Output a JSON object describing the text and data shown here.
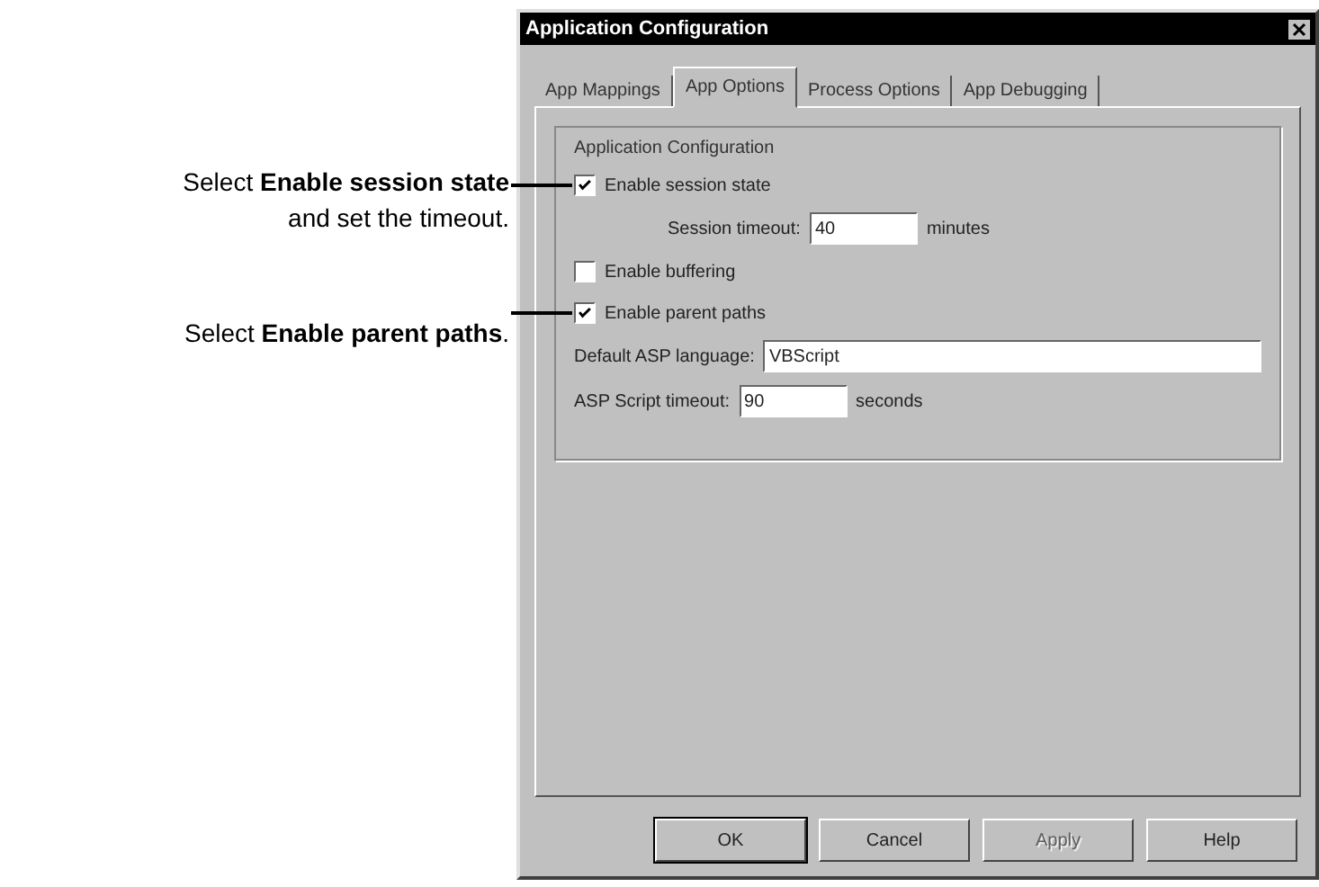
{
  "callouts": [
    {
      "text": "Select **Enable session state**",
      "note": "and set the timeout."
    },
    {
      "text": "Select **Enable parent paths**."
    }
  ],
  "dialog": {
    "title": "Application Configuration",
    "tabs": [
      {
        "label": "App Mappings",
        "selected": false
      },
      {
        "label": "App Options",
        "selected": true
      },
      {
        "label": "Process Options",
        "selected": false
      },
      {
        "label": "App Debugging",
        "selected": false
      }
    ],
    "group": {
      "label": "Application Configuration",
      "options": [
        {
          "kind": "checkbox",
          "label": "Enable session state",
          "checked": true,
          "children": [
            {
              "kind": "field",
              "label": "Session timeout:",
              "value": "40",
              "unit": "minutes"
            }
          ]
        },
        {
          "kind": "checkbox",
          "label": "Enable buffering",
          "checked": false
        },
        {
          "kind": "checkbox",
          "label": "Enable parent paths",
          "checked": true
        },
        {
          "kind": "field",
          "label": "Default ASP language:",
          "value": "VBScript"
        },
        {
          "kind": "field",
          "label": "ASP Script timeout:",
          "value": "90",
          "unit": "seconds"
        }
      ]
    },
    "buttons": [
      {
        "label": "OK",
        "default": true,
        "disabled": false
      },
      {
        "label": "Cancel",
        "default": false,
        "disabled": false
      },
      {
        "label": "Apply",
        "default": false,
        "disabled": true
      },
      {
        "label": "Help",
        "default": false,
        "disabled": false
      }
    ]
  }
}
